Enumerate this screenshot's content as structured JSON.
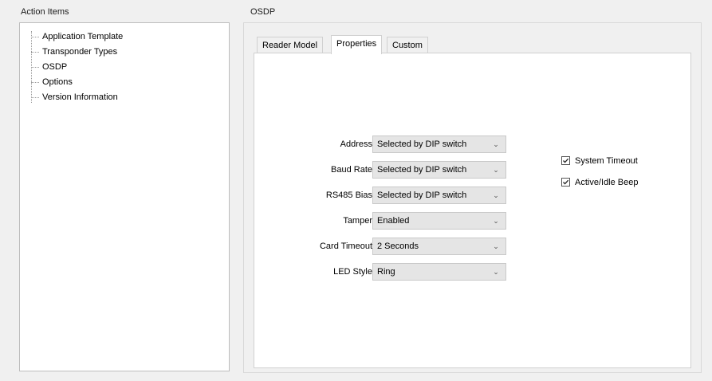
{
  "left_panel": {
    "title": "Action Items",
    "tree_items": [
      {
        "label": "Application Template"
      },
      {
        "label": "Transponder Types"
      },
      {
        "label": "OSDP"
      },
      {
        "label": "Options"
      },
      {
        "label": "Version Information"
      }
    ]
  },
  "right_panel": {
    "title": "OSDP",
    "tabs": [
      {
        "label": "Reader Model"
      },
      {
        "label": "Properties",
        "active": true
      },
      {
        "label": "Custom"
      }
    ],
    "fields": [
      {
        "label": "Address",
        "value": "Selected by DIP switch"
      },
      {
        "label": "Baud Rate",
        "value": "Selected by DIP switch"
      },
      {
        "label": "RS485 Bias",
        "value": "Selected by DIP switch"
      },
      {
        "label": "Tamper",
        "value": "Enabled"
      },
      {
        "label": "Card Timeout",
        "value": "2 Seconds"
      },
      {
        "label": "LED Style",
        "value": "Ring"
      }
    ],
    "checkboxes": [
      {
        "label": "System Timeout",
        "checked": true
      },
      {
        "label": "Active/Idle Beep",
        "checked": true
      }
    ]
  },
  "colors": {
    "background": "#f0f0f0",
    "panel": "#ffffff",
    "select_bg": "#e5e5e5"
  }
}
